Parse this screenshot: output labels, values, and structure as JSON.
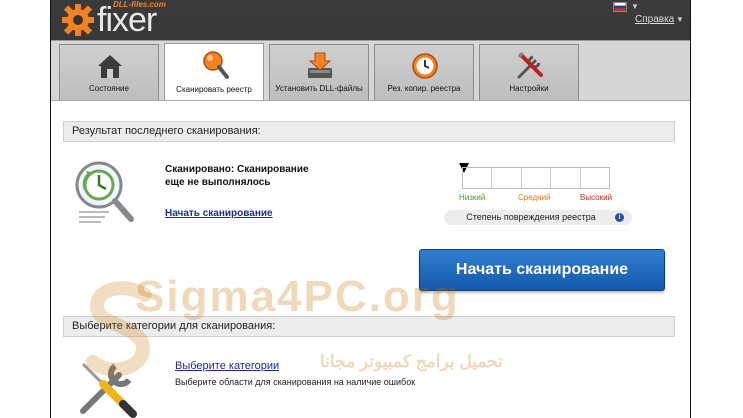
{
  "app": {
    "logo_text": "fixer",
    "logo_sub": "DLL-files.com",
    "help_label": "Справка"
  },
  "tabs": [
    {
      "label": "Состояние",
      "icon": "home-icon"
    },
    {
      "label": "Сканировать реестр",
      "icon": "magnifier-icon",
      "active": true
    },
    {
      "label": "Установить DLL-файлы",
      "icon": "download-icon"
    },
    {
      "label": "Рез. копир. реестра",
      "icon": "clock-restore-icon"
    },
    {
      "label": "Настройки",
      "icon": "tools-icon"
    }
  ],
  "last_scan": {
    "header": "Результат последнего сканирования:",
    "status_line1": "Сканировано: Сканирование",
    "status_line2": "еще не выполнялось",
    "start_link": "Начать сканирование",
    "damage_label": "Степень повреждения реестра",
    "meter": {
      "low": "Низкий",
      "mid": "Средний",
      "high": "Высокий",
      "level": 0
    },
    "start_button": "Начать сканирование"
  },
  "categories": {
    "header": "Выберите категории для сканирования:",
    "link": "Выберите категории",
    "desc": "Выберите области для сканирования на наличие ошибок"
  },
  "watermark": {
    "text": "Sigma4PC.org",
    "sub": "تحميل برامج كمبيوتر مجانا"
  },
  "colors": {
    "accent_orange": "#f58220",
    "button_blue": "#1f6bc0",
    "link_blue": "#1a2f8a",
    "low_green": "#4a9a1e",
    "mid_orange": "#e07b1a",
    "high_red": "#d62a1a"
  }
}
